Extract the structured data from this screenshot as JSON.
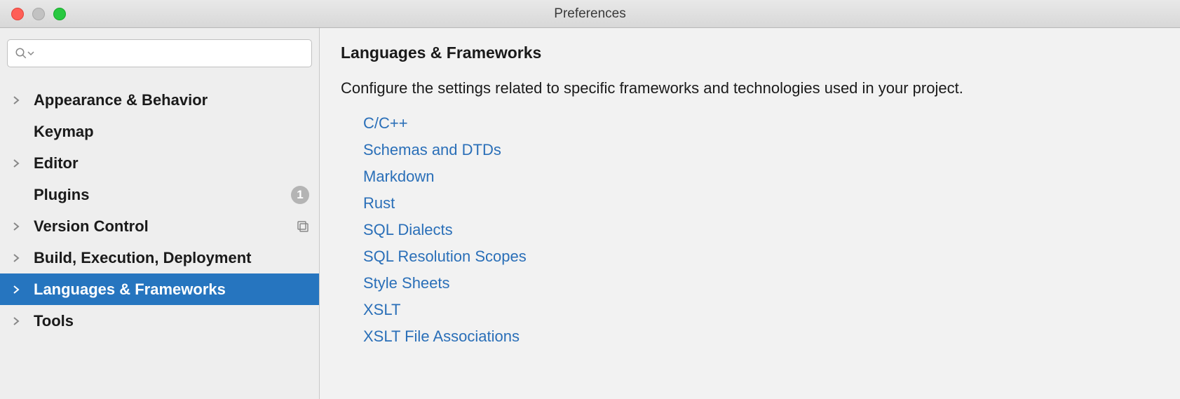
{
  "window": {
    "title": "Preferences"
  },
  "search": {
    "placeholder": ""
  },
  "sidebar": {
    "items": [
      {
        "label": "Appearance & Behavior",
        "expandable": true
      },
      {
        "label": "Keymap",
        "expandable": false
      },
      {
        "label": "Editor",
        "expandable": true
      },
      {
        "label": "Plugins",
        "expandable": false,
        "badge": "1"
      },
      {
        "label": "Version Control",
        "expandable": true,
        "project_icon": true
      },
      {
        "label": "Build, Execution, Deployment",
        "expandable": true
      },
      {
        "label": "Languages & Frameworks",
        "expandable": true,
        "selected": true
      },
      {
        "label": "Tools",
        "expandable": true
      }
    ]
  },
  "main": {
    "title": "Languages & Frameworks",
    "description": "Configure the settings related to specific frameworks and technologies used in your project.",
    "links": [
      "C/C++",
      "Schemas and DTDs",
      "Markdown",
      "Rust",
      "SQL Dialects",
      "SQL Resolution Scopes",
      "Style Sheets",
      "XSLT",
      "XSLT File Associations"
    ]
  }
}
